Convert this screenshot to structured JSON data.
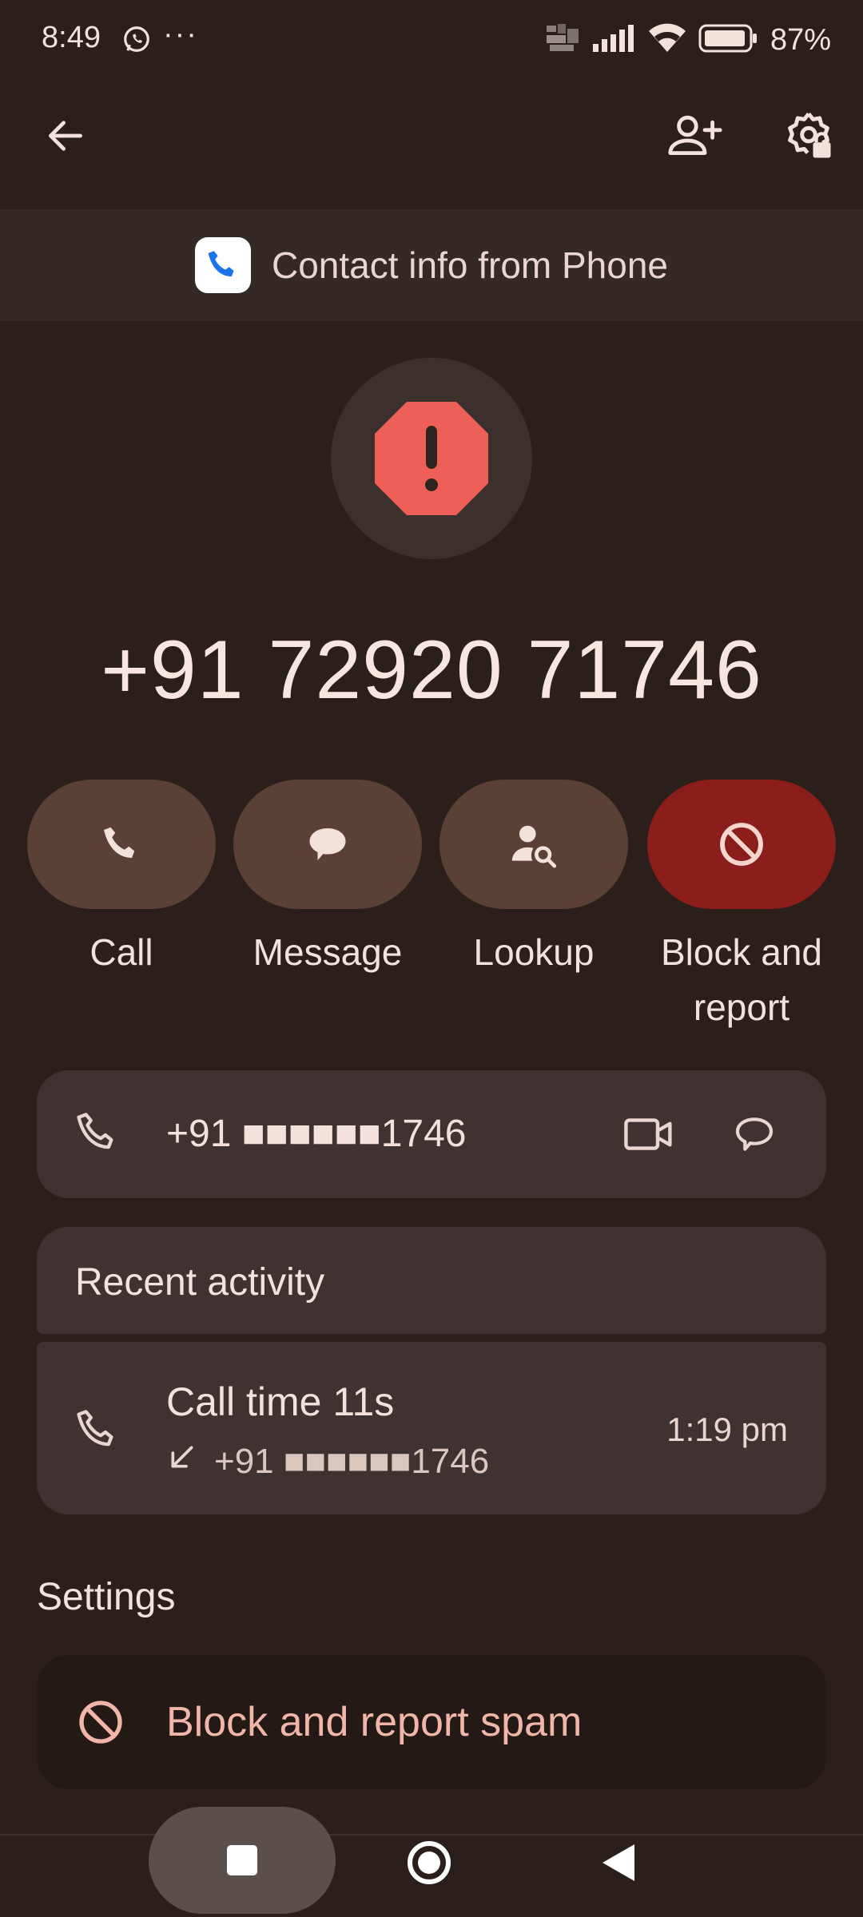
{
  "status_bar": {
    "time": "8:49",
    "dots": "···",
    "battery": "87%"
  },
  "banner": {
    "text": "Contact info from Phone"
  },
  "contact": {
    "number": "+91 72920 71746"
  },
  "actions": [
    {
      "label": "Call",
      "icon": "phone-icon"
    },
    {
      "label": "Message",
      "icon": "message-icon"
    },
    {
      "label": "Lookup",
      "icon": "person-search-icon"
    },
    {
      "label": "Block and report",
      "icon": "block-icon"
    }
  ],
  "number_card": {
    "number": "+91 ■■■■■■1746"
  },
  "recent": {
    "title": "Recent activity",
    "item": {
      "title": "Call time 11s",
      "number": "+91 ■■■■■■1746",
      "time": "1:19 pm"
    }
  },
  "settings": {
    "title": "Settings",
    "block_label": "Block and report spam"
  },
  "colors": {
    "background": "#2a1f1b",
    "action_pill": "#5a4036",
    "block_pill": "#8b1d1a",
    "spam_icon": "#ee5f57",
    "block_text": "#f2b5aa"
  }
}
